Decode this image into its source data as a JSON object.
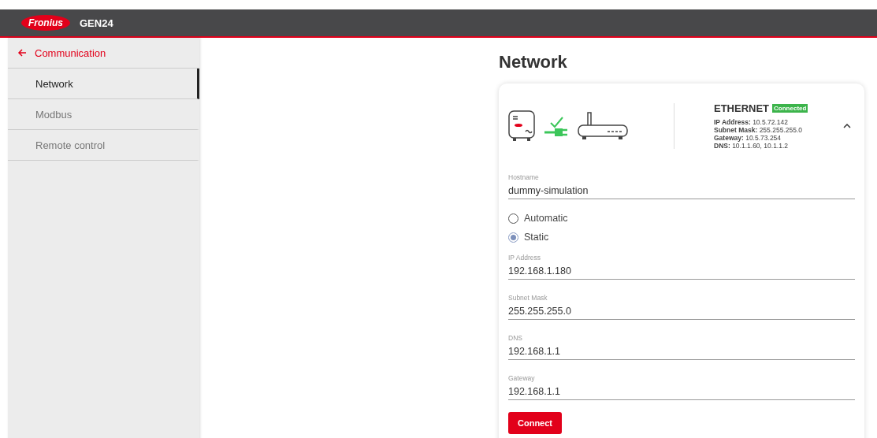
{
  "header": {
    "brand": "Fronius",
    "product": "GEN24"
  },
  "sidebar": {
    "back": "Communication",
    "items": [
      {
        "label": "Network",
        "selected": true
      },
      {
        "label": "Modbus",
        "selected": false
      },
      {
        "label": "Remote control",
        "selected": false
      }
    ]
  },
  "page": {
    "title": "Network"
  },
  "connection": {
    "title": "ETHERNET",
    "status": "Connected",
    "connected": true,
    "expanded": true,
    "details": [
      "**IP Address:** 10.5.72.142",
      "**Subnet Mask:** 255.255.255.0",
      "**Gateway:** 10.5.73.254",
      "**DNS:** 10.1.1.60, 10.1.1.2"
    ]
  },
  "hostname": {
    "label": "Hostname",
    "value": "dummy-simulation"
  },
  "mode": [
    {
      "label": "Automatic",
      "selected": false
    },
    {
      "label": "Static",
      "selected": true
    }
  ],
  "fields": [
    {
      "label": "IP Address",
      "value": "192.168.1.180"
    },
    {
      "label": "Subnet Mask",
      "value": "255.255.255.0"
    },
    {
      "label": "DNS",
      "value": "192.168.1.1"
    },
    {
      "label": "Gateway",
      "value": "192.168.1.1"
    }
  ],
  "button": "Connect"
}
